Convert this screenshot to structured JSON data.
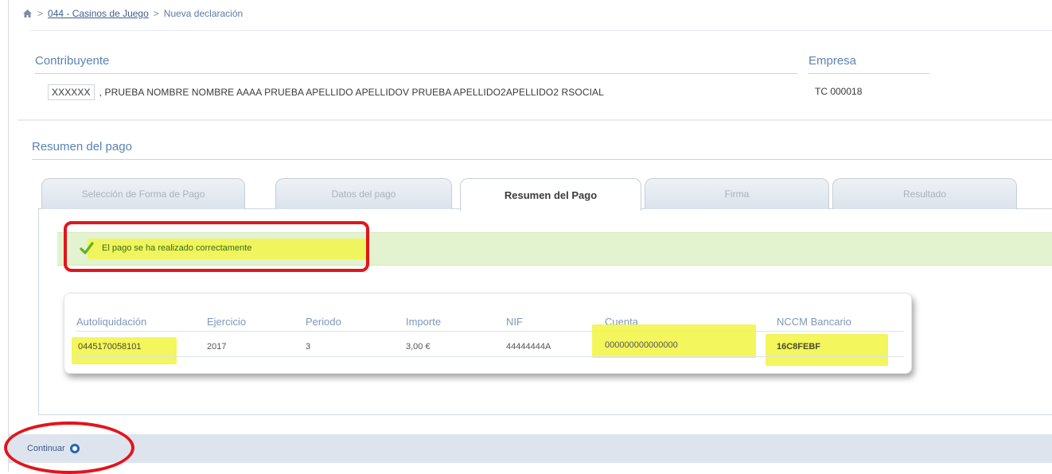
{
  "breadcrumb": {
    "separator": ">",
    "link": "044 - Casinos de Juego",
    "current": "Nueva declaración"
  },
  "contribuyente": {
    "label": "Contribuyente",
    "id": "XXXXXX",
    "value": ", PRUEBA NOMBRE NOMBRE AAAA PRUEBA APELLIDO APELLIDOV PRUEBA APELLIDO2APELLIDO2 RSOCIAL"
  },
  "empresa": {
    "label": "Empresa",
    "value": "TC  000018"
  },
  "resumen": {
    "title": "Resumen del pago"
  },
  "tabs": [
    {
      "label": "Selección de Forma de Pago",
      "active": false
    },
    {
      "label": "Datos del pago",
      "active": false
    },
    {
      "label": "Resumen del Pago",
      "active": true
    },
    {
      "label": "Firma",
      "active": false
    },
    {
      "label": "Resultado",
      "active": false
    }
  ],
  "message": {
    "text": "El pago se ha realizado correctamente",
    "icon": "checkmark-icon"
  },
  "table": {
    "headers": [
      "Autoliquidación",
      "Ejercicio",
      "Periodo",
      "Importe",
      "NIF",
      "Cuenta",
      "NCCM Bancario"
    ],
    "row": [
      "0445170058101",
      "2017",
      "3",
      "3,00 €",
      "44444444A",
      "000000000000000",
      "16C8FEBF"
    ]
  },
  "footer": {
    "continuar": "Continuar"
  },
  "colors": {
    "accent": "#5b83b6",
    "highlight": "#f2f54a",
    "annotation": "#e3141b",
    "success_bg": "#e3f3cf"
  }
}
